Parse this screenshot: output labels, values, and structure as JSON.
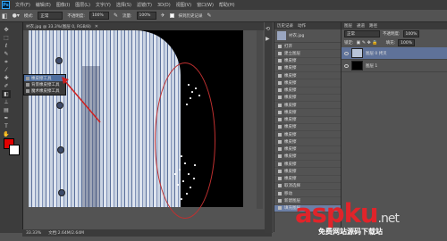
{
  "menubar": {
    "logo": "Ps",
    "items": [
      "文件(F)",
      "编辑(E)",
      "图像(I)",
      "图层(L)",
      "文字(Y)",
      "选择(S)",
      "滤镜(T)",
      "3D(D)",
      "视图(V)",
      "窗口(W)",
      "帮助(H)"
    ]
  },
  "options": {
    "mode_label": "模式:",
    "mode_value": "正常",
    "opacity_label": "不透明度:",
    "opacity_value": "100%",
    "flow_label": "流量:",
    "flow_value": "100%",
    "erase_history_label": "抹到历史记录"
  },
  "document": {
    "tab_title": "衬衣.jpg @ 33.3%(图层 0, RGB/8)"
  },
  "flyout": {
    "items": [
      "橡皮擦工具",
      "背景橡皮擦工具",
      "魔术橡皮擦工具"
    ]
  },
  "status": {
    "zoom": "33.33%",
    "doc": "文档:2.64M/2.64M"
  },
  "history": {
    "tab1": "历史记录",
    "tab2": "动作",
    "snapshot": "衬衣.jpg",
    "items": [
      "打开",
      "建立图层",
      "橡皮擦",
      "橡皮擦",
      "橡皮擦",
      "橡皮擦",
      "橡皮擦",
      "橡皮擦",
      "橡皮擦",
      "橡皮擦",
      "橡皮擦",
      "橡皮擦",
      "橡皮擦",
      "橡皮擦",
      "橡皮擦",
      "橡皮擦",
      "橡皮擦",
      "橡皮擦",
      "橡皮擦",
      "取消选择",
      "移动",
      "新建图层",
      "填充图层"
    ]
  },
  "layers": {
    "tab1": "图层",
    "tab2": "通道",
    "tab3": "路径",
    "blend_mode": "正常",
    "opacity_label": "不透明度:",
    "opacity_value": "100%",
    "lock_label": "锁定:",
    "fill_label": "填充:",
    "fill_value": "100%",
    "items": [
      {
        "name": "图层 0 拷贝",
        "selected": true
      },
      {
        "name": "图层 1",
        "selected": false
      }
    ]
  },
  "watermark": {
    "brand_a": "asp",
    "brand_b": "ku",
    "brand_net": ".net",
    "sub": "免费网站源码下载站"
  },
  "colors": {
    "foreground": "#e00000",
    "background": "#ffffff",
    "annotation": "#c03030"
  }
}
